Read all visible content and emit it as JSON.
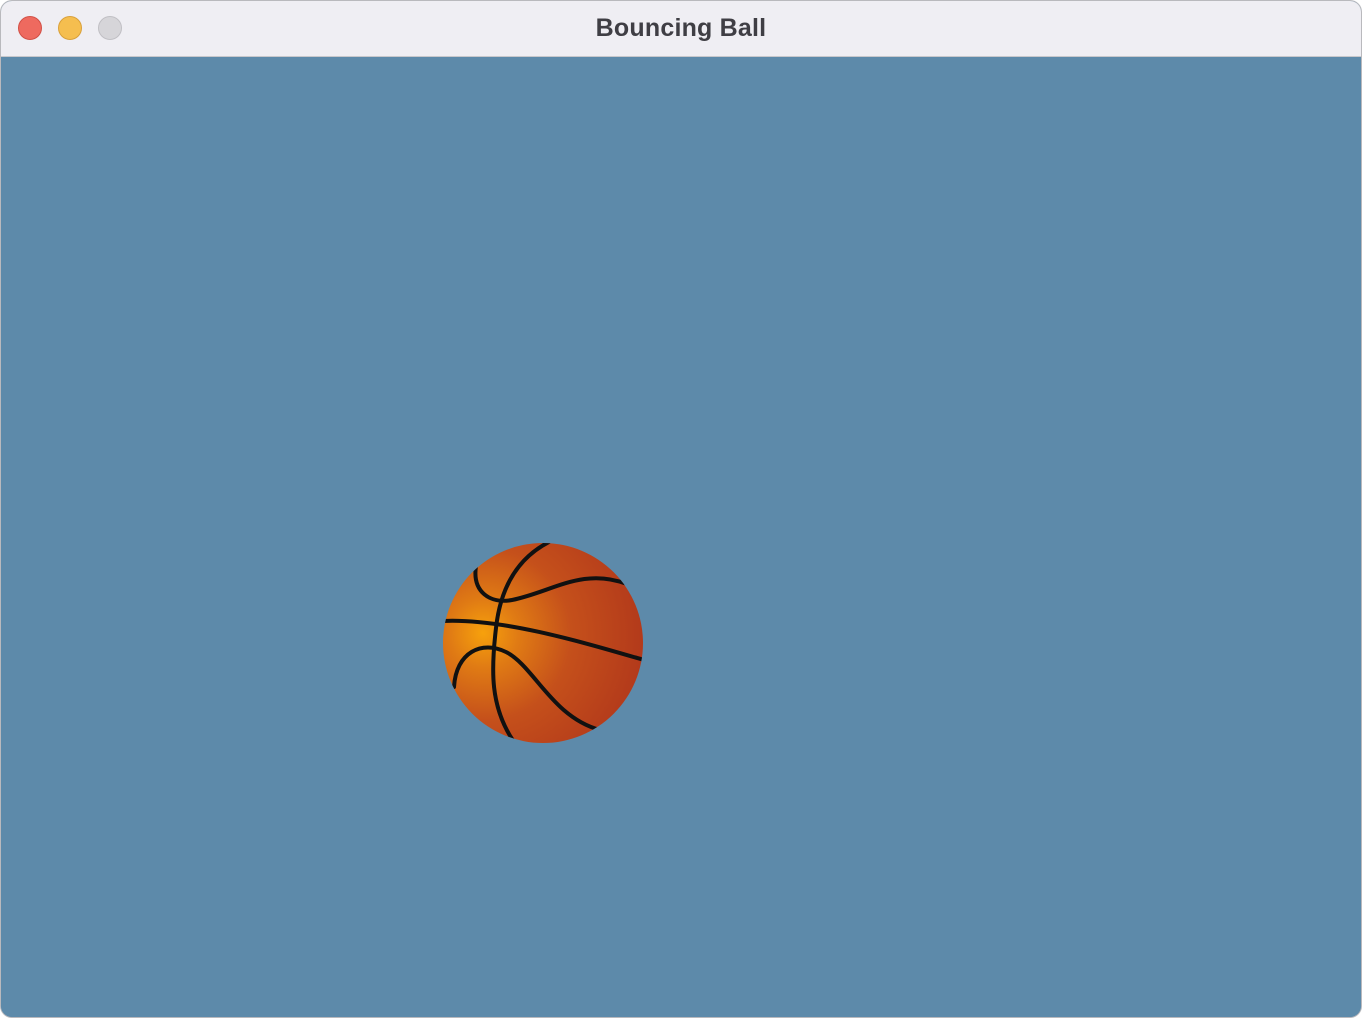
{
  "window": {
    "title": "Bouncing Ball"
  },
  "canvas": {
    "background_color": "#5d8aaa"
  },
  "ball": {
    "type": "basketball",
    "icon": "basketball-icon",
    "colors": {
      "highlight": "#f59c0e",
      "body": "#b83a1a",
      "seams": "#111111"
    }
  },
  "traffic_lights": {
    "close_color": "#ee6a5f",
    "minimize_color": "#f5be4f",
    "zoom_color": "#d6d5d9"
  }
}
